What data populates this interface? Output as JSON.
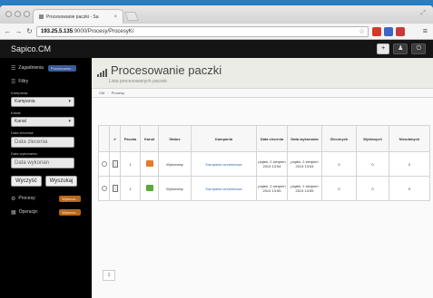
{
  "browser": {
    "tab_title": "Procesowanie paczki - Sa",
    "url_host": "193.25.5.135",
    "url_rest": ":9000/Procesy/ProcesyK/",
    "colors": {
      "ext1": "#d43a2a",
      "ext2": "#3a66c8",
      "ext3": "#c83a3a"
    }
  },
  "topbar": {
    "brand": "Sapico.CM",
    "add_label": "+",
    "user_label": "♟",
    "power_label": "⏻"
  },
  "sidebar": {
    "zagadnienia": {
      "label": "Zagadnienia",
      "badge": "Procesowan..."
    },
    "filtry": {
      "label": "Filtry"
    },
    "kampania": {
      "label": "Kampania:",
      "value": "Kampania"
    },
    "kanal": {
      "label": "Kanał:",
      "value": "Kanał"
    },
    "data_zlecenia": {
      "label": "Data zlecenia:",
      "placeholder": "Data zlecenia"
    },
    "data_wykonania": {
      "label": "Data wykonania:",
      "placeholder": "Data wykonan"
    },
    "btn_clear": "Wyczyść",
    "btn_search": "Wyszukaj",
    "procesy": {
      "label": "Procesy:",
      "badge": "Wykona..."
    },
    "operacje": {
      "label": "Operacje:",
      "badge": "Wykona..."
    }
  },
  "content": {
    "title": "Procesowanie paczki",
    "subtitle": "Lista procesowanych paczek",
    "crumb1": "CM",
    "crumb2": "Procesy"
  },
  "table": {
    "headers": {
      "hash": "#",
      "paczka": "Paczka",
      "kanal": "Kanał",
      "status": "Status",
      "kampania": "Kampania",
      "data_zlecenia": "Data zlecenia",
      "data_wykonania": "Data wykonania",
      "zleconych": "Zleconych",
      "wyslanych": "Wysłanych",
      "nieudanych": "Nieudanych"
    },
    "rows": [
      {
        "paczka": "1",
        "status": "Wykonany",
        "kampania": "Kampania wrześniowa",
        "data_zlecenia": "piątek, 2 sierpień 2013 13:54",
        "data_wykonania": "piątek, 2 sierpień 2013 13:54",
        "zleconych": "0",
        "wyslanych": "0",
        "nieudanych": "0",
        "kanal_color": "#e07b2a"
      },
      {
        "paczka": "1",
        "status": "Wykonany",
        "kampania": "Kampania wrześniowa",
        "data_zlecenia": "piątek, 2 sierpień 2013 13:55",
        "data_wykonania": "piątek, 2 sierpień 2013 13:55",
        "zleconych": "0",
        "wyslanych": "0",
        "nieudanych": "0",
        "kanal_color": "#5aaa3a"
      }
    ],
    "pager": "1"
  }
}
